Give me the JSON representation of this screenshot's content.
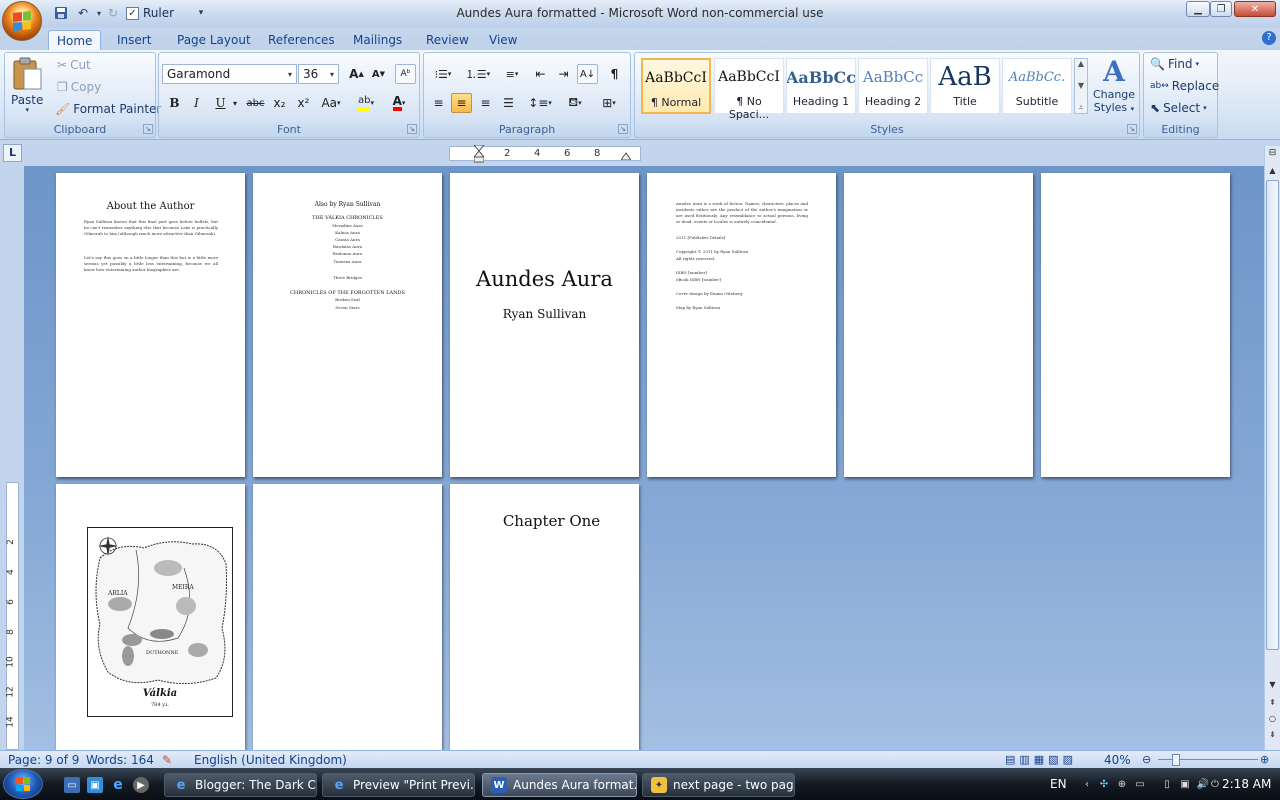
{
  "window": {
    "title": "Aundes Aura formatted - Microsoft Word non-commercial use",
    "ruler_checkbox_label": "Ruler",
    "ruler_checked": true
  },
  "tabs": [
    "Home",
    "Insert",
    "Page Layout",
    "References",
    "Mailings",
    "Review",
    "View"
  ],
  "active_tab": "Home",
  "clipboard": {
    "paste": "Paste",
    "cut": "Cut",
    "copy": "Copy",
    "format_painter": "Format Painter",
    "label": "Clipboard"
  },
  "font": {
    "name": "Garamond",
    "size": "36",
    "label": "Font",
    "bold": "B",
    "italic": "I",
    "underline": "U",
    "strikethrough": "abc",
    "subscript": "x₂",
    "superscript": "x²",
    "change_case": "Aa",
    "grow": "A",
    "shrink": "A",
    "highlight_color": "#ffff00",
    "font_color": "#ff0000"
  },
  "paragraph": {
    "label": "Paragraph"
  },
  "styles": {
    "label": "Styles",
    "items": [
      {
        "preview": "AaBbCcI",
        "name": "¶ Normal",
        "selected": true
      },
      {
        "preview": "AaBbCcI",
        "name": "¶ No Spaci..."
      },
      {
        "preview": "AaBbCc",
        "name": "Heading 1"
      },
      {
        "preview": "AaBbCc",
        "name": "Heading 2"
      },
      {
        "preview": "AaB",
        "name": "Title"
      },
      {
        "preview": "AaBbCc.",
        "name": "Subtitle"
      }
    ],
    "change_styles_line1": "Change",
    "change_styles_line2": "Styles"
  },
  "editing": {
    "label": "Editing",
    "find": "Find",
    "replace": "Replace",
    "select": "Select"
  },
  "ruler": {
    "corner": "L",
    "ticks": [
      "2",
      "4",
      "6",
      "8"
    ],
    "vticks": [
      "2",
      "4",
      "6",
      "8",
      "10",
      "12",
      "14"
    ]
  },
  "pages": {
    "about": {
      "heading": "About the Author",
      "para1": "Ryan Sullivan knows that this final part goes before bullets, but he can't remember anything else that because Lake is practically Gilmerah to him (although much more attractive than Gilmerah).",
      "para2": "Let's say this goes on a little longer than this but is a little more serious yet possibly a little less entertaining, because we all know how entertaining author biographies are."
    },
    "also_by": {
      "heading": "Also by Ryan Sullivan",
      "series1": "THE VÁLKIA CHRONICLES",
      "series1_books": [
        "Meradine Aura",
        "Kalnas Aura",
        "Cansia Aura",
        "Bardalas Aura",
        "Bralonna Aura",
        "Tamvina Aura"
      ],
      "standalone": "Three Bridges",
      "series2": "CHRONICLES OF THE FORGOTTEN LANDS",
      "series2_books": [
        "Broken Seal",
        "Seven Stars"
      ]
    },
    "title": {
      "title": "Aundes Aura",
      "author": "Ryan Sullivan"
    },
    "copyright": {
      "line1": "Aundes Aura is a work of fiction. Names, characters, places and incidents either are the product of the author's imagination or are used fictitiously. Any resemblance to actual persons, living or dead, events or locales is entirely coincidental.",
      "line2": "2011 [Publisher Details]",
      "line3": "Copyright © 2011 by Ryan Sullivan",
      "line4": "All rights reserved.",
      "line5": "ISBN [number]",
      "line6": "eBook ISBN [number]",
      "line7": "Cover design by Emma Ottoberg",
      "line8": "Map by Ryan Sullivan"
    },
    "map": {
      "region1": "ARLIA",
      "region2": "MEIRA",
      "region3": "DUTHONNE",
      "map_title": "Válkia",
      "map_sub": "784 y.i."
    },
    "chapter": {
      "heading": "Chapter One"
    }
  },
  "status": {
    "page": "Page: 9 of 9",
    "words": "Words: 164",
    "language": "English (United Kingdom)",
    "zoom": "40%"
  },
  "taskbar": {
    "items": [
      {
        "label": "Blogger: The Dark C..."
      },
      {
        "label": "Preview \"Print Previ..."
      },
      {
        "label": "Aundes Aura format...",
        "active": true
      },
      {
        "label": "next page - two pag..."
      }
    ],
    "lang": "EN",
    "clock": "2:18 AM"
  }
}
